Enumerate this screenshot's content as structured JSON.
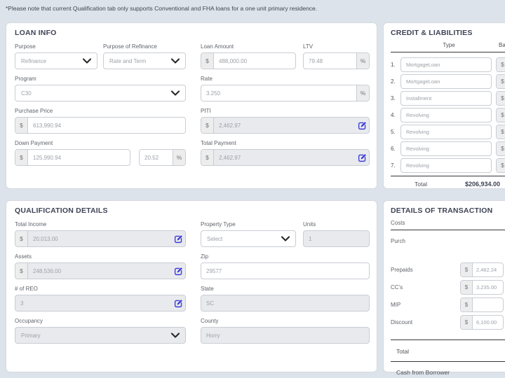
{
  "colors": {
    "page_background": "#dde3ea",
    "panel_background": "#ffffff",
    "title_text": "#3e4356",
    "input_text": "#9ca0a6",
    "disabled_input_background": "#e9eaee",
    "edit_icon_accent": "#3c3cd6",
    "divider_dark": "#36373b"
  },
  "note": "*Please note that current Qualification tab only supports Conventional and FHA loans for a one unit primary residence.",
  "loan_info": {
    "title": "LOAN INFO",
    "purpose": {
      "label": "Purpose",
      "value": "Refinance"
    },
    "purpose_of_refinance": {
      "label": "Purpose of Refinance",
      "value": "Rate and Term"
    },
    "loan_amount": {
      "label": "Loan Amount",
      "prefix": "$",
      "value": "488,000.00"
    },
    "ltv": {
      "label": "LTV",
      "value": "79.48",
      "suffix": "%"
    },
    "program": {
      "label": "Program",
      "value": "C30"
    },
    "rate": {
      "label": "Rate",
      "value": "3.250",
      "suffix": "%"
    },
    "purchase_price": {
      "label": "Purchase Price",
      "prefix": "$",
      "value": "613,990.94"
    },
    "piti": {
      "label": "PITI",
      "prefix": "$",
      "value": "2,462.97"
    },
    "down_payment": {
      "label": "Down Payment",
      "prefix": "$",
      "value": "125,990.94",
      "percent": "20.52",
      "suffix": "%"
    },
    "total_payment": {
      "label": "Total Payment",
      "prefix": "$",
      "value": "2,462.97"
    }
  },
  "credit_liabilities": {
    "title": "CREDIT & LIABILITIES",
    "columns": {
      "type": "Type",
      "balance": "Balance"
    },
    "rows": [
      {
        "num": "1.",
        "type": "MortgageLoan",
        "balance_prefix": "$",
        "balance": ""
      },
      {
        "num": "2.",
        "type": "MortgageLoan",
        "balance_prefix": "$",
        "balance": ""
      },
      {
        "num": "3.",
        "type": "Installment",
        "balance_prefix": "$",
        "balance": ""
      },
      {
        "num": "4.",
        "type": "Revolving",
        "balance_prefix": "$",
        "balance": ""
      },
      {
        "num": "5.",
        "type": "Revolving",
        "balance_prefix": "$",
        "balance": ""
      },
      {
        "num": "6.",
        "type": "Revolving",
        "balance_prefix": "$",
        "balance": ""
      },
      {
        "num": "7.",
        "type": "Revolving",
        "balance_prefix": "$",
        "balance": ""
      }
    ],
    "total_label": "Total",
    "total_value": "$206,934.00"
  },
  "qualification_details": {
    "title": "QUALIFICATION DETAILS",
    "total_income": {
      "label": "Total Income",
      "prefix": "$",
      "value": "20,013.00"
    },
    "assets": {
      "label": "Assets",
      "prefix": "$",
      "value": "248,536.00"
    },
    "num_of_reo": {
      "label": "# of REO",
      "value": "3"
    },
    "occupancy": {
      "label": "Occupancy",
      "value": "Primary"
    },
    "property_type": {
      "label": "Property Type",
      "value": "Select"
    },
    "units": {
      "label": "Units",
      "value": "1"
    },
    "zip": {
      "label": "Zip",
      "value": "29577"
    },
    "state": {
      "label": "State",
      "value": "SC"
    },
    "county": {
      "label": "County",
      "value": "Horry"
    }
  },
  "details_of_transaction": {
    "title": "DETAILS OF TRANSACTION",
    "costs_header": "Costs",
    "purch_label": "Purch",
    "rows": [
      {
        "label": "Prepaids",
        "prefix": "$",
        "value": "2,462.24"
      },
      {
        "label": "CC's",
        "prefix": "$",
        "value": "3,235.00"
      },
      {
        "label": "MIP",
        "prefix": "$",
        "value": ""
      },
      {
        "label": "Discount",
        "prefix": "$",
        "value": "6,100.00"
      }
    ],
    "total_label": "Total",
    "cash_from_borrower_label": "Cash from Borrower"
  }
}
